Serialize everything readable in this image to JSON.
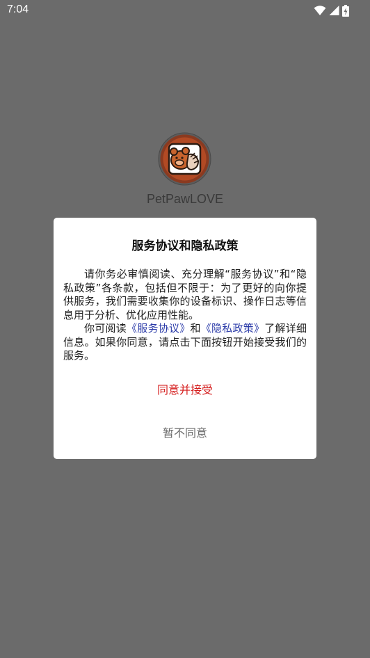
{
  "status_bar": {
    "time": "7:04",
    "icons": [
      "wifi-icon",
      "signal-icon",
      "battery-charging-icon"
    ]
  },
  "splash": {
    "logo_icon": "petpaw-logo-icon",
    "app_name": "PetPawLOVE"
  },
  "dialog": {
    "title": "服务协议和隐私政策",
    "paragraph1": "请你务必审慎阅读、充分理解“服务协议”和“隐私政策”各条款，包括但不限于：为了更好的向你提供服务，我们需要收集你的设备标识、操作日志等信息用于分析、优化应用性能。",
    "paragraph2_prefix": "你可阅读",
    "service_link": "《服务协议》",
    "paragraph2_and": "和",
    "privacy_link": "《隐私政策》",
    "paragraph2_suffix": "了解详细信息。如果你同意，请点击下面按钮开始接受我们的服务。",
    "accept_label": "同意并接受",
    "decline_label": "暂不同意"
  },
  "colors": {
    "overlay": "#6b6b6b",
    "accept": "#d41a1a",
    "link": "#2a3aa8",
    "decline": "#6a6a6a"
  }
}
